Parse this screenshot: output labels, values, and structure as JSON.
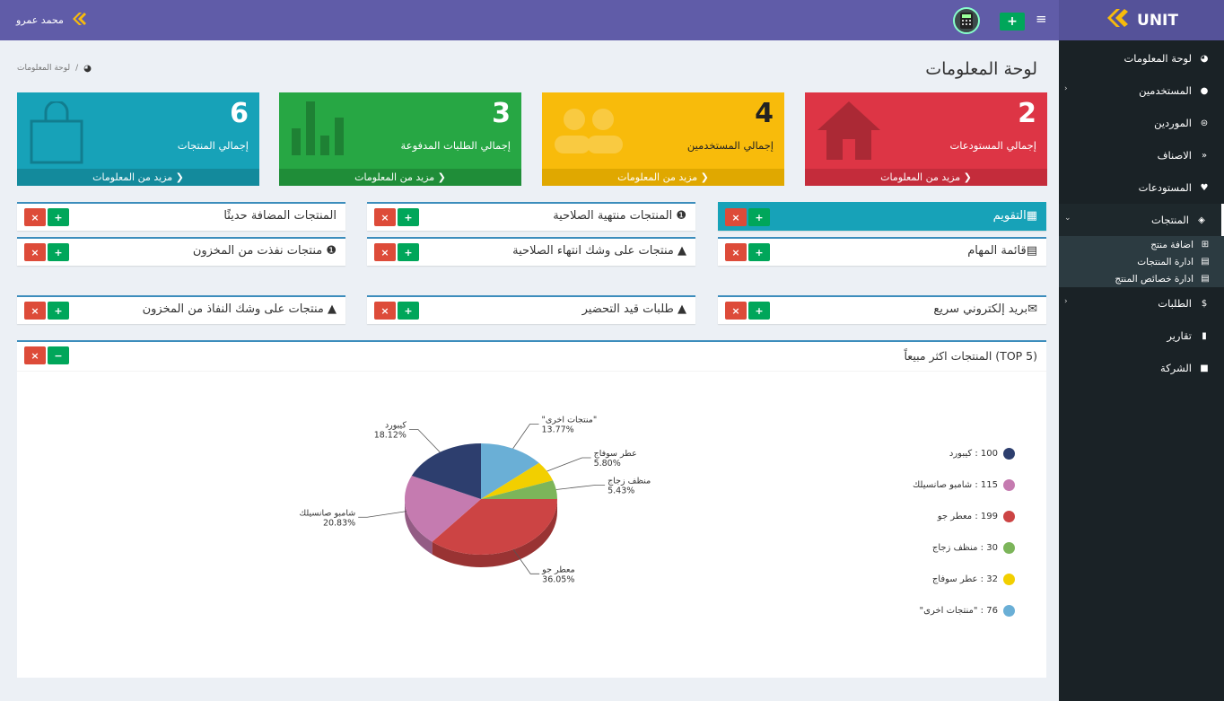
{
  "brand": "UNIT",
  "user": "محمد عمرو",
  "page_title": "لوحة المعلومات",
  "breadcrumb": "لوحة المعلومات",
  "sidebar": {
    "items": [
      {
        "label": "لوحة المعلومات",
        "icon": "dashboard-icon"
      },
      {
        "label": "المستخدمين",
        "icon": "users-icon",
        "arrow": true
      },
      {
        "label": "الموردين",
        "icon": "handshake-icon"
      },
      {
        "label": "الاصناف",
        "icon": "code-icon"
      },
      {
        "label": "المستودعات",
        "icon": "map-marker-icon"
      },
      {
        "label": "المنتجات",
        "icon": "cube-icon",
        "active": true
      },
      {
        "label": "الطلبات",
        "icon": "dollar-icon",
        "arrow": true
      },
      {
        "label": "تقارير",
        "icon": "bar-chart-icon"
      },
      {
        "label": "الشركة",
        "icon": "briefcase-icon"
      }
    ],
    "subitems": [
      {
        "label": "اضافة منتج"
      },
      {
        "label": "ادارة المنتجات"
      },
      {
        "label": "ادارة خصائص المنتج"
      }
    ]
  },
  "tiles": [
    {
      "num": "2",
      "label": "إجمالي المستودعات",
      "foot": "مزيد من المعلومات",
      "color": "#dd3545"
    },
    {
      "num": "4",
      "label": "إجمالي المستخدمين",
      "foot": "مزيد من المعلومات",
      "color": "#f8bb0b"
    },
    {
      "num": "3",
      "label": "إجمالي الطلبات المدفوعة",
      "foot": "مزيد من المعلومات",
      "color": "#27a744"
    },
    {
      "num": "6",
      "label": "إجمالي المنتجات",
      "foot": "مزيد من المعلومات",
      "color": "#17a2b8"
    }
  ],
  "boxes": {
    "calendar": "التقويم",
    "expired": "المنتجات منتهية الصلاحية",
    "recent": "المنتجات المضافة حديثًا",
    "tasks": "قائمة المهام",
    "near_expiry": "منتجات على وشك انتهاء الصلاحية",
    "out_of_stock": "منتجات نفذت من المخزون",
    "quick_mail": "بريد إلكتروني سريع",
    "orders_prep": "طلبات قيد التحضير",
    "near_out": "منتجات على وشك النفاذ من المخزون"
  },
  "chart_title": "المنتجات اكثر مبيعاً (TOP 5)",
  "chart_data": {
    "type": "pie",
    "categories": [
      "كيبورد",
      "شامبو صانسيلك",
      "معطر جو",
      "منظف زجاج",
      "عطر سوفاج",
      "\"منتجات اخرى\""
    ],
    "values": [
      100,
      115,
      199,
      30,
      32,
      76
    ],
    "percent_labels": [
      "18.12%",
      "20.83%",
      "36.05%",
      "5.43%",
      "5.80%",
      "13.77%"
    ],
    "colors": [
      "#2d3e6e",
      "#c57bb0",
      "#cc4444",
      "#7cb55a",
      "#f2cf00",
      "#6aafd6"
    ]
  },
  "legend": [
    {
      "text": "100 : كيبورد"
    },
    {
      "text": "115 : شامبو صانسيلك"
    },
    {
      "text": "199 : معطر جو"
    },
    {
      "text": "30 : منظف زجاج"
    },
    {
      "text": "32 : عطر سوفاج"
    },
    {
      "text": "76 : \"منتجات اخرى\""
    }
  ]
}
